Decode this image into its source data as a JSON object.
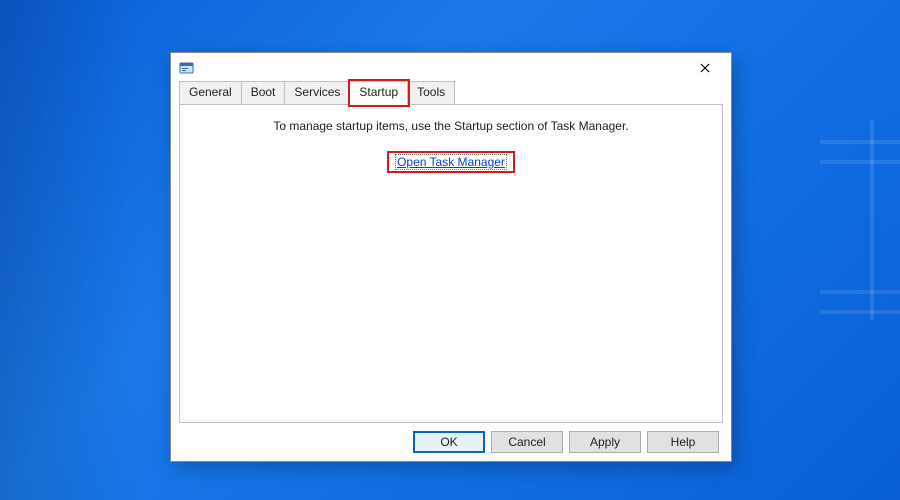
{
  "tabs": {
    "general": "General",
    "boot": "Boot",
    "services": "Services",
    "startup": "Startup",
    "tools": "Tools",
    "active": "startup"
  },
  "startup_page": {
    "message": "To manage startup items, use the Startup section of Task Manager.",
    "link_text": "Open Task Manager"
  },
  "buttons": {
    "ok": "OK",
    "cancel": "Cancel",
    "apply": "Apply",
    "help": "Help"
  }
}
